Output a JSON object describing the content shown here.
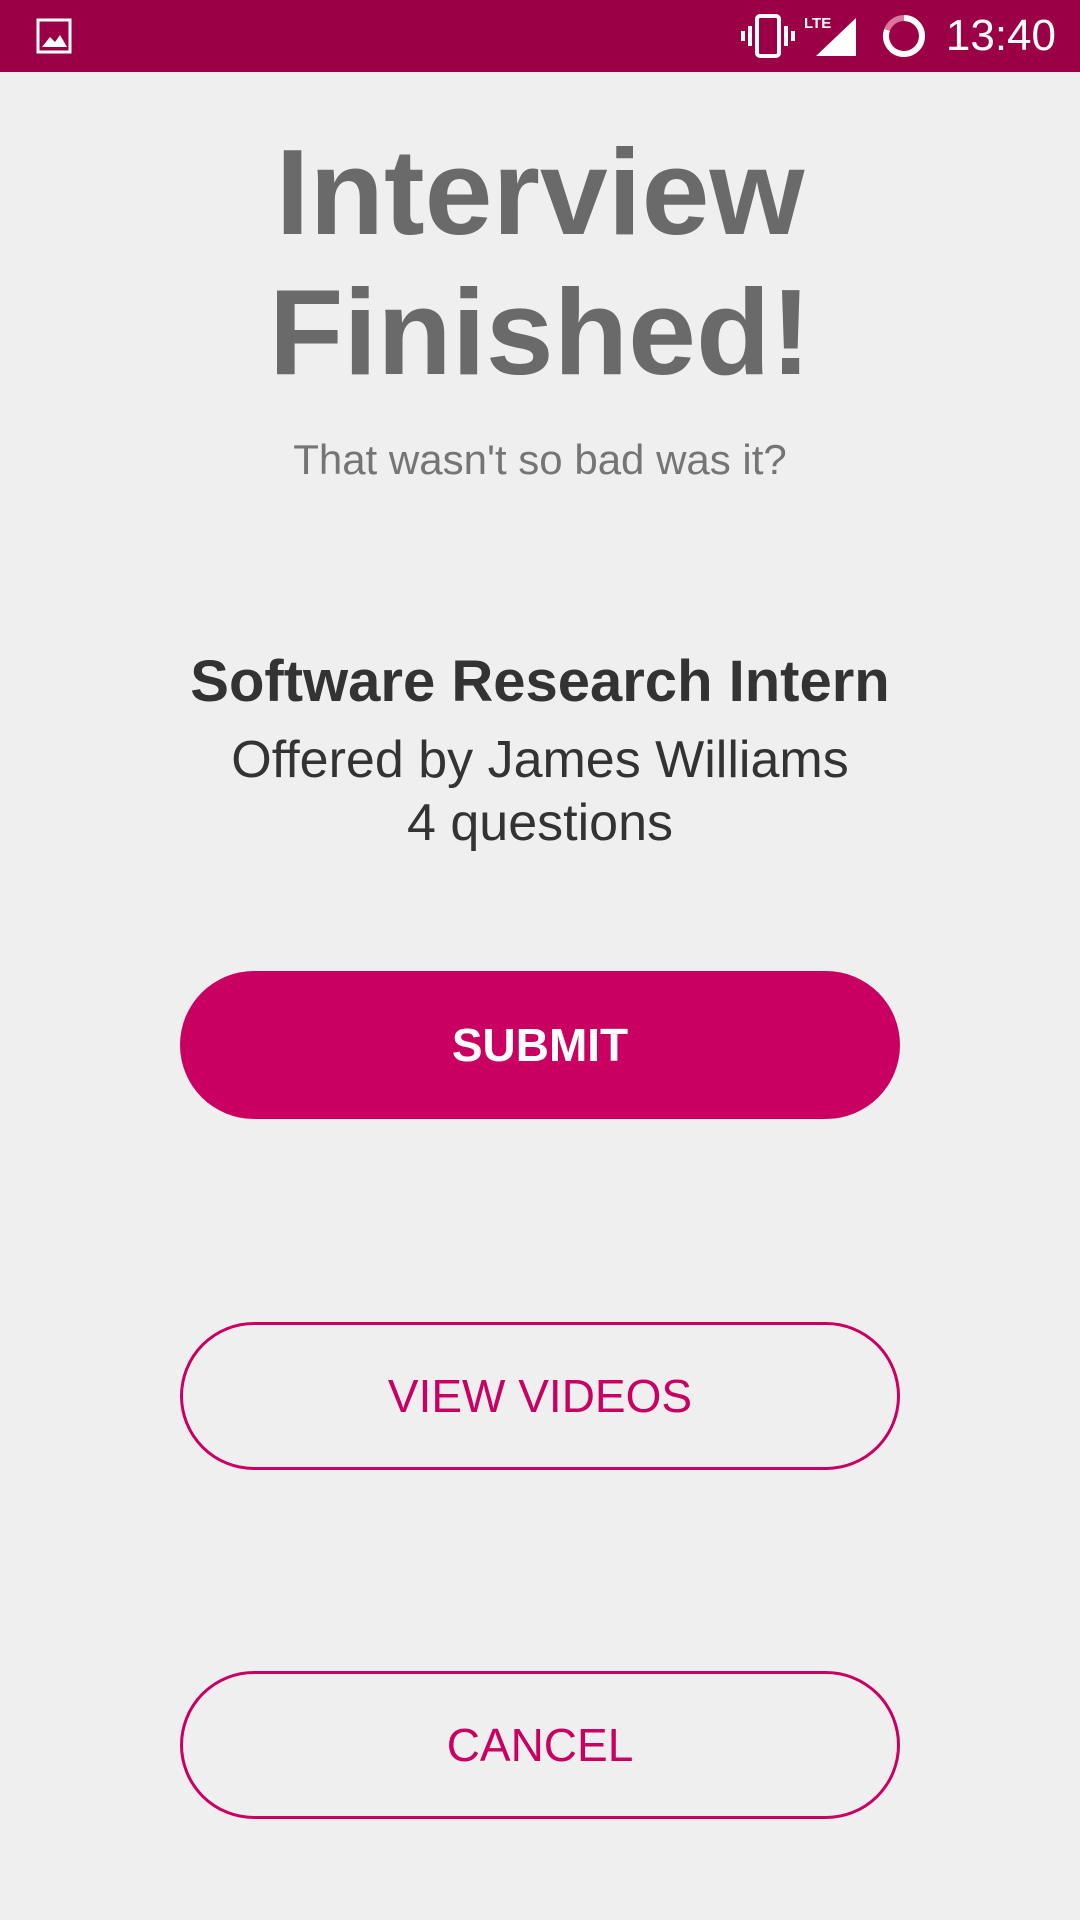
{
  "status_bar": {
    "time": "13:40",
    "network_label": "LTE",
    "icons": [
      "gallery-icon",
      "vibrate-icon",
      "lte-signal-icon",
      "battery-icon"
    ],
    "background_color": "#9b0047"
  },
  "main": {
    "headline_line1": "Interview",
    "headline_line2": "Finished!",
    "subtitle": "That wasn't so bad was it?",
    "job": {
      "title": "Software Research Intern",
      "offered_by": "Offered by James Williams",
      "questions": "4 questions"
    }
  },
  "actions": {
    "submit_label": "SUBMIT",
    "view_videos_label": "VIEW VIDEOS",
    "cancel_label": "CANCEL"
  },
  "colors": {
    "accent": "#c90062",
    "background": "#efeff0",
    "headline_text": "#6a6a6a"
  }
}
